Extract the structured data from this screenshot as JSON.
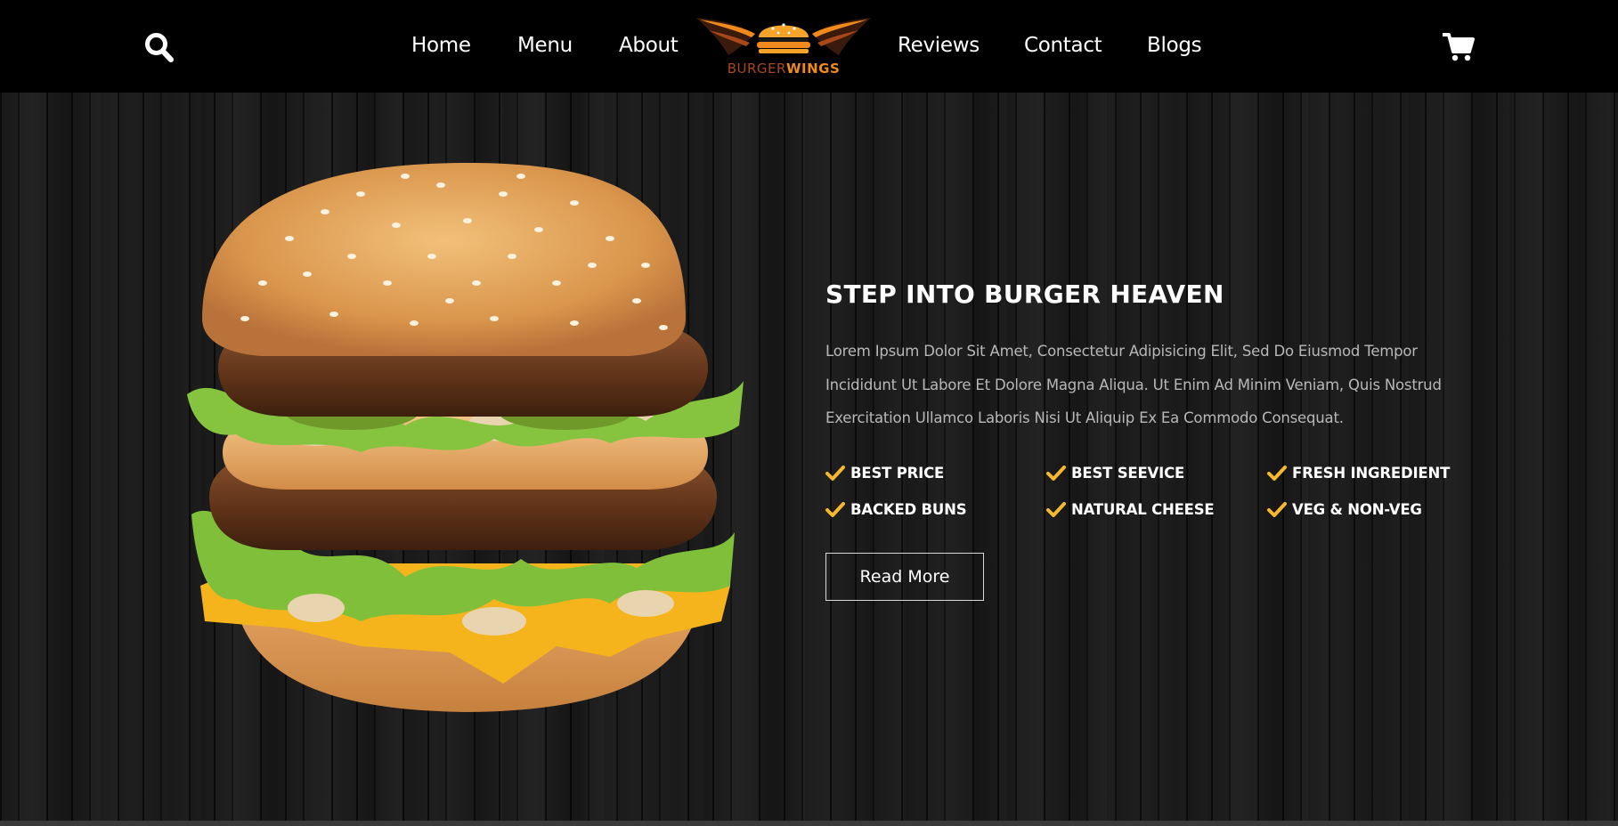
{
  "header": {
    "search_icon": "search-icon",
    "cart_icon": "shopping-cart-icon",
    "nav_left": [
      "Home",
      "Menu",
      "About"
    ],
    "nav_right": [
      "Reviews",
      "Contact",
      "Blogs"
    ],
    "logo": {
      "text_part1": "BURGER",
      "text_part2": "WINGS"
    }
  },
  "hero": {
    "image": "burger-image",
    "title": "STEP INTO BURGER HEAVEN",
    "paragraph": "Lorem Ipsum Dolor Sit Amet, Consectetur Adipisicing Elit, Sed Do Eiusmod Tempor Incididunt Ut Labore Et Dolore Magna Aliqua. Ut Enim Ad Minim Veniam, Quis Nostrud Exercitation Ullamco Laboris Nisi Ut Aliquip Ex Ea Commodo Consequat.",
    "features": [
      "BEST PRICE",
      "BEST SEEVICE",
      "FRESH INGREDIENT",
      "BACKED BUNS",
      "NATURAL CHEESE",
      "VEG & NON-VEG"
    ],
    "feature_icon": "check-icon",
    "button_label": "Read More"
  },
  "colors": {
    "header_bg": "#000000",
    "accent": "#f5b82e",
    "logo_orange": "#f08a1c",
    "text_muted": "#b8b8b8"
  }
}
